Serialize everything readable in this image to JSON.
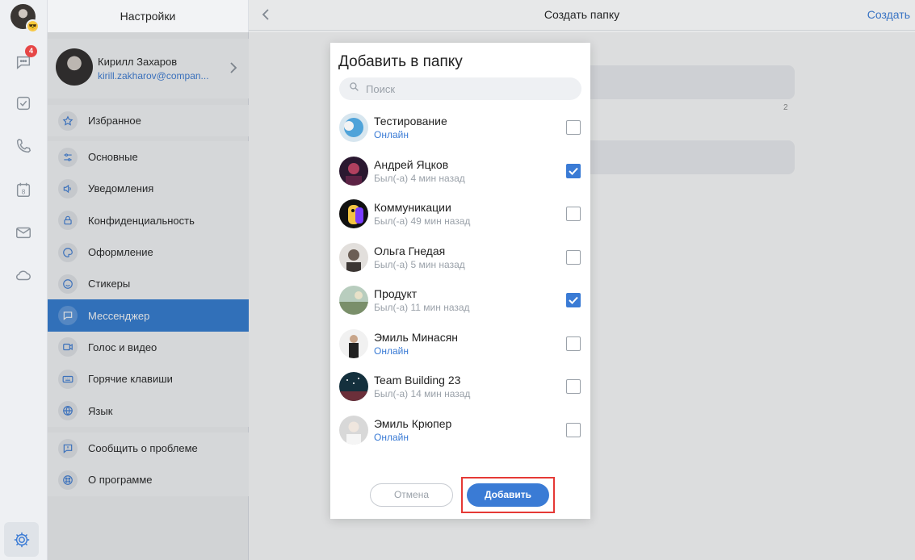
{
  "rail": {
    "badge_count": "4",
    "icons": [
      "avatar",
      "chat-icon",
      "tasks-icon",
      "phone-icon",
      "calendar-icon",
      "mail-icon",
      "cloud-icon",
      "settings-icon"
    ],
    "calendar_day": "8"
  },
  "settings": {
    "title": "Настройки",
    "profile": {
      "name": "Кирилл Захаров",
      "email": "kirill.zakharov@compan..."
    },
    "groups": [
      [
        {
          "label": "Избранное",
          "icon": "star-icon"
        }
      ],
      [
        {
          "label": "Основные",
          "icon": "sliders-icon"
        },
        {
          "label": "Уведомления",
          "icon": "speaker-icon"
        },
        {
          "label": "Конфиденциальность",
          "icon": "lock-icon"
        },
        {
          "label": "Оформление",
          "icon": "palette-icon"
        },
        {
          "label": "Стикеры",
          "icon": "smile-icon"
        },
        {
          "label": "Мессенджер",
          "icon": "message-icon",
          "active": true
        },
        {
          "label": "Голос и видео",
          "icon": "video-icon"
        },
        {
          "label": "Горячие клавиши",
          "icon": "keyboard-icon"
        },
        {
          "label": "Язык",
          "icon": "globe-icon"
        }
      ],
      [
        {
          "label": "Сообщить о проблеме",
          "icon": "report-icon"
        },
        {
          "label": "О программе",
          "icon": "about-icon"
        }
      ]
    ]
  },
  "main": {
    "title": "Создать папку",
    "create_label": "Создать",
    "counter": "2"
  },
  "dialog": {
    "title": "Добавить в папку",
    "search_placeholder": "Поиск",
    "contacts": [
      {
        "name": "Тестирование",
        "status": "Онлайн",
        "online": true,
        "checked": false,
        "avatar_color": "#4fa3d9"
      },
      {
        "name": "Андрей Яцков",
        "status": "Был(-а) 4 мин назад",
        "online": false,
        "checked": true,
        "avatar_color": "#3b1f3a"
      },
      {
        "name": "Коммуникации",
        "status": "Был(-а) 49 мин назад",
        "online": false,
        "checked": false,
        "avatar_color": "#f4c542"
      },
      {
        "name": "Ольга Гнедая",
        "status": "Был(-а) 5 мин назад",
        "online": false,
        "checked": false,
        "avatar_color": "#c9c4bf"
      },
      {
        "name": "Продукт",
        "status": "Был(-а) 11 мин назад",
        "online": false,
        "checked": true,
        "avatar_color": "#8fb3a0"
      },
      {
        "name": "Эмиль Минасян",
        "status": "Онлайн",
        "online": true,
        "checked": false,
        "avatar_color": "#e9e9e9"
      },
      {
        "name": "Team Building 23",
        "status": "Был(-а) 14 мин назад",
        "online": false,
        "checked": false,
        "avatar_color": "#1f3a4a"
      },
      {
        "name": "Эмиль Крюпер",
        "status": "Онлайн",
        "online": true,
        "checked": false,
        "avatar_color": "#d8d8d8"
      }
    ],
    "cancel_label": "Отмена",
    "add_label": "Добавить"
  }
}
